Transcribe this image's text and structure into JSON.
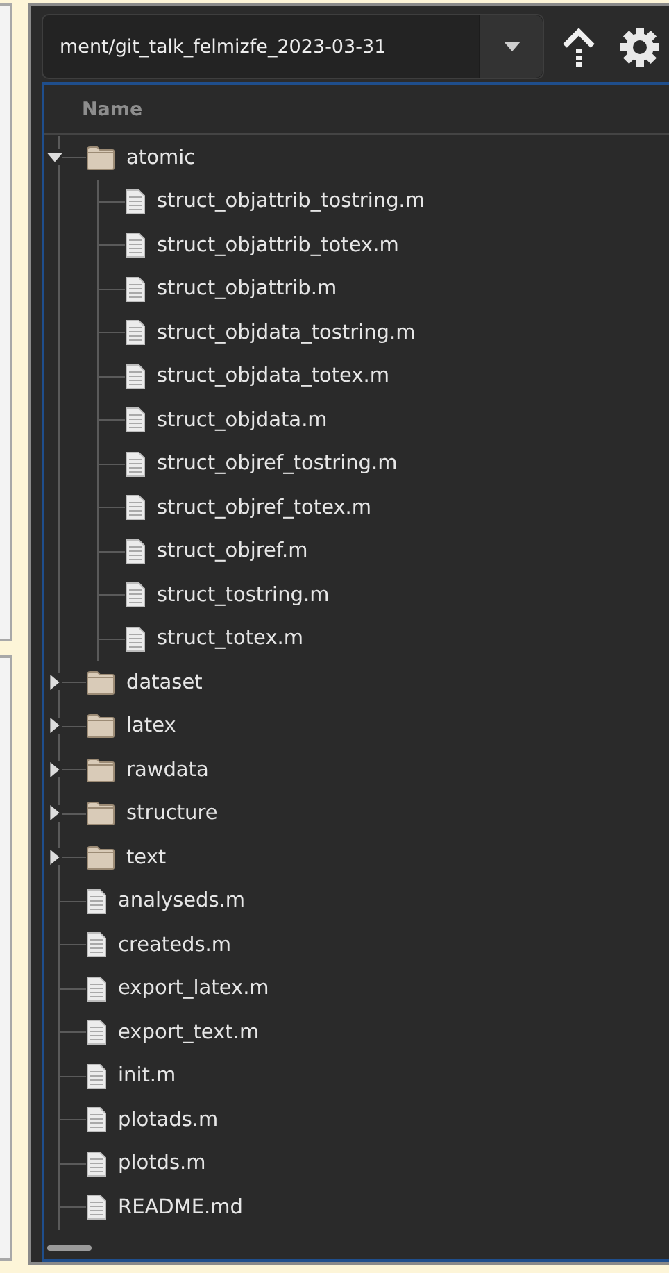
{
  "toolbar": {
    "path": "ment/git_talk_felmizfe_2023-03-31"
  },
  "tree": {
    "header": "Name",
    "items": [
      {
        "kind": "folder",
        "name": "atomic",
        "expanded": true,
        "children": [
          {
            "kind": "file",
            "name": "struct_objattrib_tostring.m"
          },
          {
            "kind": "file",
            "name": "struct_objattrib_totex.m"
          },
          {
            "kind": "file",
            "name": "struct_objattrib.m"
          },
          {
            "kind": "file",
            "name": "struct_objdata_tostring.m"
          },
          {
            "kind": "file",
            "name": "struct_objdata_totex.m"
          },
          {
            "kind": "file",
            "name": "struct_objdata.m"
          },
          {
            "kind": "file",
            "name": "struct_objref_tostring.m"
          },
          {
            "kind": "file",
            "name": "struct_objref_totex.m"
          },
          {
            "kind": "file",
            "name": "struct_objref.m"
          },
          {
            "kind": "file",
            "name": "struct_tostring.m"
          },
          {
            "kind": "file",
            "name": "struct_totex.m"
          }
        ]
      },
      {
        "kind": "folder",
        "name": "dataset",
        "expanded": false
      },
      {
        "kind": "folder",
        "name": "latex",
        "expanded": false
      },
      {
        "kind": "folder",
        "name": "rawdata",
        "expanded": false
      },
      {
        "kind": "folder",
        "name": "structure",
        "expanded": false
      },
      {
        "kind": "folder",
        "name": "text",
        "expanded": false
      },
      {
        "kind": "file",
        "name": "analyseds.m"
      },
      {
        "kind": "file",
        "name": "createds.m"
      },
      {
        "kind": "file",
        "name": "export_latex.m"
      },
      {
        "kind": "file",
        "name": "export_text.m"
      },
      {
        "kind": "file",
        "name": "init.m"
      },
      {
        "kind": "file",
        "name": "plotads.m"
      },
      {
        "kind": "file",
        "name": "plotds.m"
      },
      {
        "kind": "file",
        "name": "README.md"
      }
    ]
  }
}
